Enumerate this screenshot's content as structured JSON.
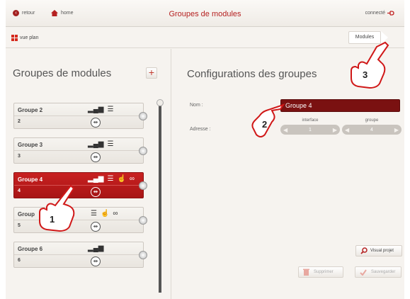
{
  "header": {
    "back_label": "retour",
    "home_label": "home",
    "title": "Groupes de modules",
    "connected_label": "connecté"
  },
  "subbar": {
    "plan_label": "vue plan",
    "modules_tab": "Modules"
  },
  "left": {
    "heading": "Groupes de modules",
    "groups": [
      {
        "name": "Groupe 2",
        "address": "2",
        "icons": [
          "chart-icon",
          "traffic-light-icon"
        ],
        "active": false
      },
      {
        "name": "Groupe 3",
        "address": "3",
        "icons": [
          "chart-icon",
          "traffic-light-icon"
        ],
        "active": false
      },
      {
        "name": "Groupe 4",
        "address": "4",
        "icons": [
          "chart-icon",
          "traffic-light-icon",
          "hand-icon",
          "link-icon"
        ],
        "active": true
      },
      {
        "name": "Group",
        "address": "5",
        "icons": [
          "traffic-light-icon",
          "hand-icon",
          "link-icon"
        ],
        "active": false
      },
      {
        "name": "Groupe 6",
        "address": "6",
        "icons": [
          "chart-icon"
        ],
        "active": false
      }
    ]
  },
  "right": {
    "heading": "Configurations des groupes",
    "name_label": "Nom :",
    "name_value": "Groupe 4",
    "address_label": "Adresse :",
    "interface_caption": "interface",
    "interface_value": "1",
    "groupe_caption": "groupe",
    "groupe_value": "4",
    "visual_label": "Visual projet",
    "delete_label": "Supprimer",
    "save_label": "Sauvegarder"
  },
  "callouts": [
    "1",
    "2",
    "3"
  ],
  "colors": {
    "accent": "#c02020",
    "background": "#f6f3ef"
  }
}
